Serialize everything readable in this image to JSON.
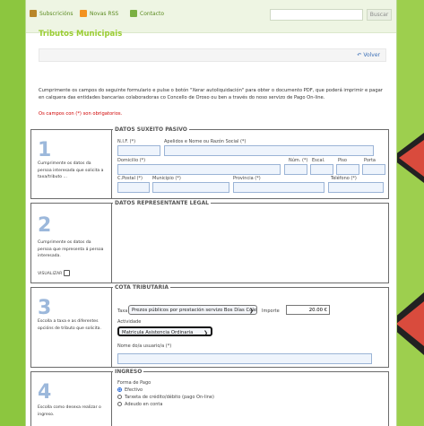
{
  "topbar": {
    "subscriptions": "Subscricións",
    "rss": "Novas RSS",
    "contact": "Contacto",
    "search_button": "Buscar"
  },
  "title": "Tributos Municipais",
  "back_link": "Volver",
  "intro": "Cumprimente os campos do seguinte formulario e pulse o botón \"Xerar autoliquidación\" para obter o documento PDF, que poderá imprimir e pagar en calquera das entidades bancarias colaboradoras co Concello de Oroso ou ben a través do noso servizo de Pago On-line.",
  "required_note": "Os campos con (*) son obrigatorios.",
  "section1": {
    "number": "1",
    "side_text": "Cumprimente os datos da persoa interesada que solicita a taxa/tributo ...",
    "legend": "DATOS SUXEITO PASIVO",
    "nif": "N.I.F. (*)",
    "name": "Apelidos e Nome ou Razón Social (*)",
    "address": "Domicilio (*)",
    "num": "Núm. (*)",
    "stair": "Escal.",
    "floor": "Piso",
    "door": "Porta",
    "postal": "C.Postal (*)",
    "municipality": "Municipio (*)",
    "province": "Provincia (*)",
    "phone": "Teléfono (*)"
  },
  "section2": {
    "number": "2",
    "side_text": "Cumprimente os datos da persoa que representa á persoa interesada.",
    "visualize": "VISUALIZAR",
    "legend": "DATOS REPRESENTANTE LEGAL"
  },
  "section3": {
    "number": "3",
    "side_text": "Escolla a taxa e as diferentes opcións de tributo que solicita.",
    "legend": "COTA TRIBUTARIA",
    "tax_label": "Taxa",
    "tax_value": "Prezos públicos por prestación servizo Bos Días Cole",
    "amount_label": "Importe",
    "amount_value": "20.00 €",
    "activity_label": "Actividade",
    "activity_value": "Matricula Asistencia Ordinaria",
    "username_label": "Nome do/a usuario/a (*)"
  },
  "section4": {
    "number": "4",
    "side_text": "Escolla como desexa realizar o ingreso.",
    "legend": "INGRESO",
    "pay_label": "Forma de Pago",
    "options": [
      "Efectivo",
      "Tarxeta de crédito/débito (pago On-line)",
      "Adeudo en conta"
    ]
  },
  "colors": {
    "background": "#8cc63f",
    "title": "#9acd32",
    "sign_red": "#d94b3d"
  }
}
